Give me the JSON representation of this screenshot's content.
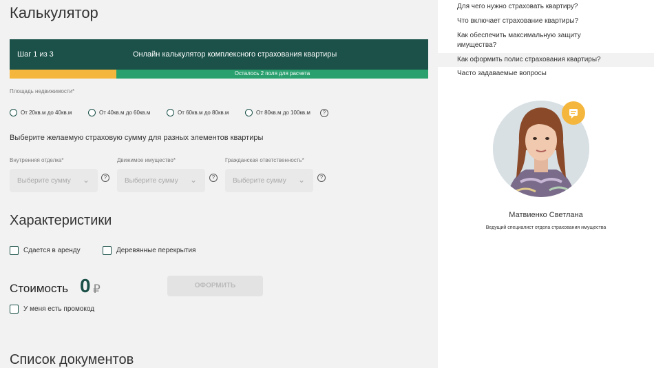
{
  "calculator": {
    "title": "Калькулятор",
    "step": "Шаг 1 из 3",
    "step_title": "Онлайн калькулятор комплексного страхования квартиры",
    "progress_fraction": 0.255,
    "remaining": "Осталось 2 поля для расчета",
    "area_label": "Площадь недвижимости*",
    "area_options": [
      "От 20кв.м до 40кв.м",
      "От 40кв.м до 60кв.м",
      "От 60кв.м до 80кв.м",
      "От 80кв.м до 100кв.м"
    ],
    "sum_subtitle": "Выберите желаемую страховую сумму для разных элементов квартиры",
    "selects": [
      {
        "label": "Внутренняя отделка*",
        "placeholder": "Выберите сумму"
      },
      {
        "label": "Движимое имущество*",
        "placeholder": "Выберите сумму"
      },
      {
        "label": "Гражданская ответственность*",
        "placeholder": "Выберите сумму"
      }
    ],
    "help_symbol": "?",
    "chevron": "⌄"
  },
  "characteristics": {
    "title": "Характеристики",
    "rented": "Сдается в аренду",
    "wooden": "Деревянные перекрытия"
  },
  "price": {
    "label": "Стоимость",
    "value": "0",
    "currency": "₽",
    "button": "ОФОРМИТЬ",
    "promo": "У меня есть промокод"
  },
  "documents": {
    "title": "Список документов"
  },
  "sidebar": {
    "faq": [
      "Для чего нужно страховать квартиру?",
      "Что включает страхование квартиры?",
      "Как обеспечить максимальную защиту имущества?",
      "Как оформить полис страхования квартиры?",
      "Часто задаваемые вопросы"
    ],
    "person_name": "Матвиенко Светлана",
    "person_role": "Ведущий специалист отдела страхования имущества"
  },
  "colors": {
    "brand_dark": "#1b5149",
    "brand_green": "#2aa06f",
    "accent_yellow": "#f4b63c"
  }
}
